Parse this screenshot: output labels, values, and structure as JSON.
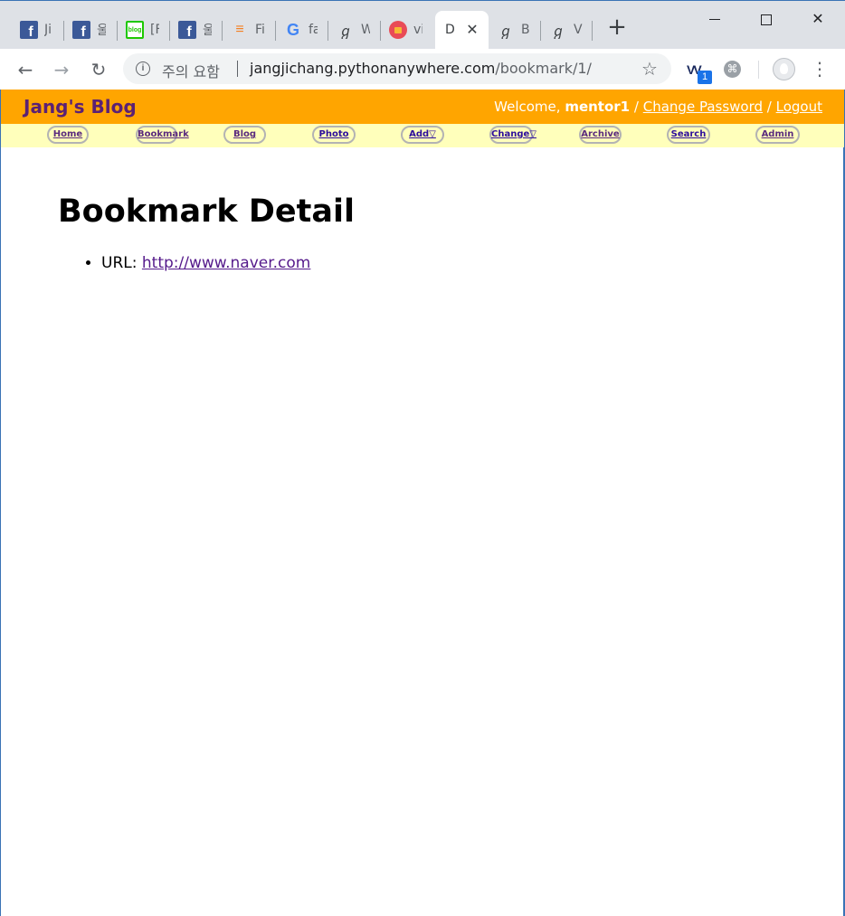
{
  "browser": {
    "tabs": [
      {
        "title": "Ji",
        "icon": "facebook-icon"
      },
      {
        "title": "울",
        "icon": "facebook-icon"
      },
      {
        "title": "[F",
        "icon": "naver-blog-icon",
        "icon_text": "blog"
      },
      {
        "title": "울",
        "icon": "facebook-icon"
      },
      {
        "title": "Fi",
        "icon": "stackoverflow-icon"
      },
      {
        "title": "fa",
        "icon": "google-icon"
      },
      {
        "title": "W",
        "icon": "django-icon"
      },
      {
        "title": "vi",
        "icon": "red-circle-icon"
      },
      {
        "title": "D",
        "icon": "none",
        "active": true
      },
      {
        "title": "B",
        "icon": "django-icon"
      },
      {
        "title": "V",
        "icon": "django-icon"
      }
    ],
    "omnibox": {
      "security_label": "주의 요함",
      "url_host": "jangjichang.pythonanywhere.com",
      "url_path": "/bookmark/1/"
    },
    "extension_badge": "1"
  },
  "site": {
    "title": "Jang's Blog",
    "welcome_text": "Welcome,",
    "username": "mentor1",
    "separator": "/",
    "change_password": "Change Password",
    "logout": "Logout",
    "header_color": "#ffa500",
    "title_color": "#5b2174",
    "menubar_color": "#ffffbb"
  },
  "menu": [
    {
      "label": "Home",
      "visited": true
    },
    {
      "label": "Bookmark",
      "visited": true
    },
    {
      "label": "Blog",
      "visited": true
    },
    {
      "label": "Photo",
      "visited": false
    },
    {
      "label": "Add▽",
      "visited": false
    },
    {
      "label": "Change▽",
      "visited": false
    },
    {
      "label": "Archive",
      "visited": true
    },
    {
      "label": "Search",
      "visited": false
    },
    {
      "label": "Admin",
      "visited": true
    }
  ],
  "main": {
    "heading": "Bookmark Detail",
    "url_label": "URL:",
    "url_value": "http://www.naver.com"
  }
}
